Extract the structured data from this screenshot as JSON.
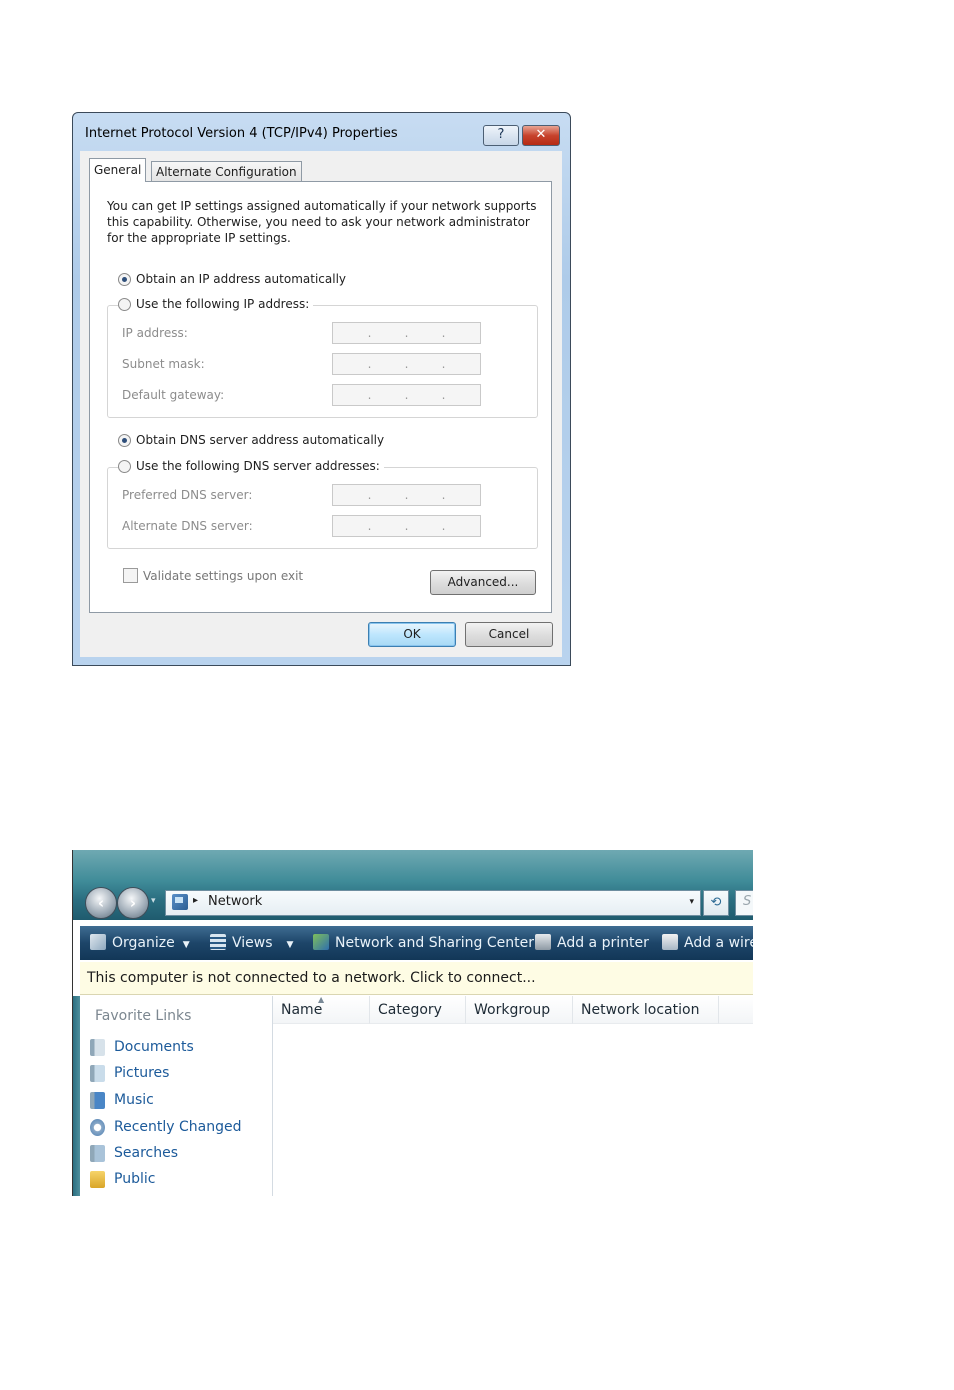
{
  "dialog": {
    "title": "Internet Protocol Version 4 (TCP/IPv4) Properties",
    "help_button": "?",
    "close_button": "✕",
    "tabs": [
      "General",
      "Alternate Configuration"
    ],
    "description": "You can get IP settings assigned automatically if your network supports this capability. Otherwise, you need to ask your network administrator for the appropriate IP settings.",
    "ip_auto_label": "Obtain an IP address automatically",
    "ip_auto_selected": true,
    "ip_manual_label": "Use the following IP address:",
    "ip_fields": [
      {
        "label": "IP address:",
        "value": ""
      },
      {
        "label": "Subnet mask:",
        "value": ""
      },
      {
        "label": "Default gateway:",
        "value": ""
      }
    ],
    "dns_auto_label": "Obtain DNS server address automatically",
    "dns_auto_selected": true,
    "dns_manual_label": "Use the following DNS server addresses:",
    "dns_fields": [
      {
        "label": "Preferred DNS server:",
        "value": ""
      },
      {
        "label": "Alternate DNS server:",
        "value": ""
      }
    ],
    "validate_label": "Validate settings upon exit",
    "validate_checked": false,
    "advanced_button": "Advanced...",
    "ok_button": "OK",
    "cancel_button": "Cancel"
  },
  "explorer": {
    "address": {
      "location": "Network",
      "search_placeholder": "S"
    },
    "toolbar": {
      "organize": "Organize",
      "views": "Views",
      "network_center": "Network and Sharing Center",
      "add_printer": "Add a printer",
      "add_wireless": "Add a wire"
    },
    "infobar": "This computer is not connected to a network. Click to connect...",
    "favorite_links": {
      "title": "Favorite Links",
      "items": [
        "Documents",
        "Pictures",
        "Music",
        "Recently Changed",
        "Searches",
        "Public"
      ]
    },
    "columns": [
      "Name",
      "Category",
      "Workgroup",
      "Network location"
    ]
  }
}
